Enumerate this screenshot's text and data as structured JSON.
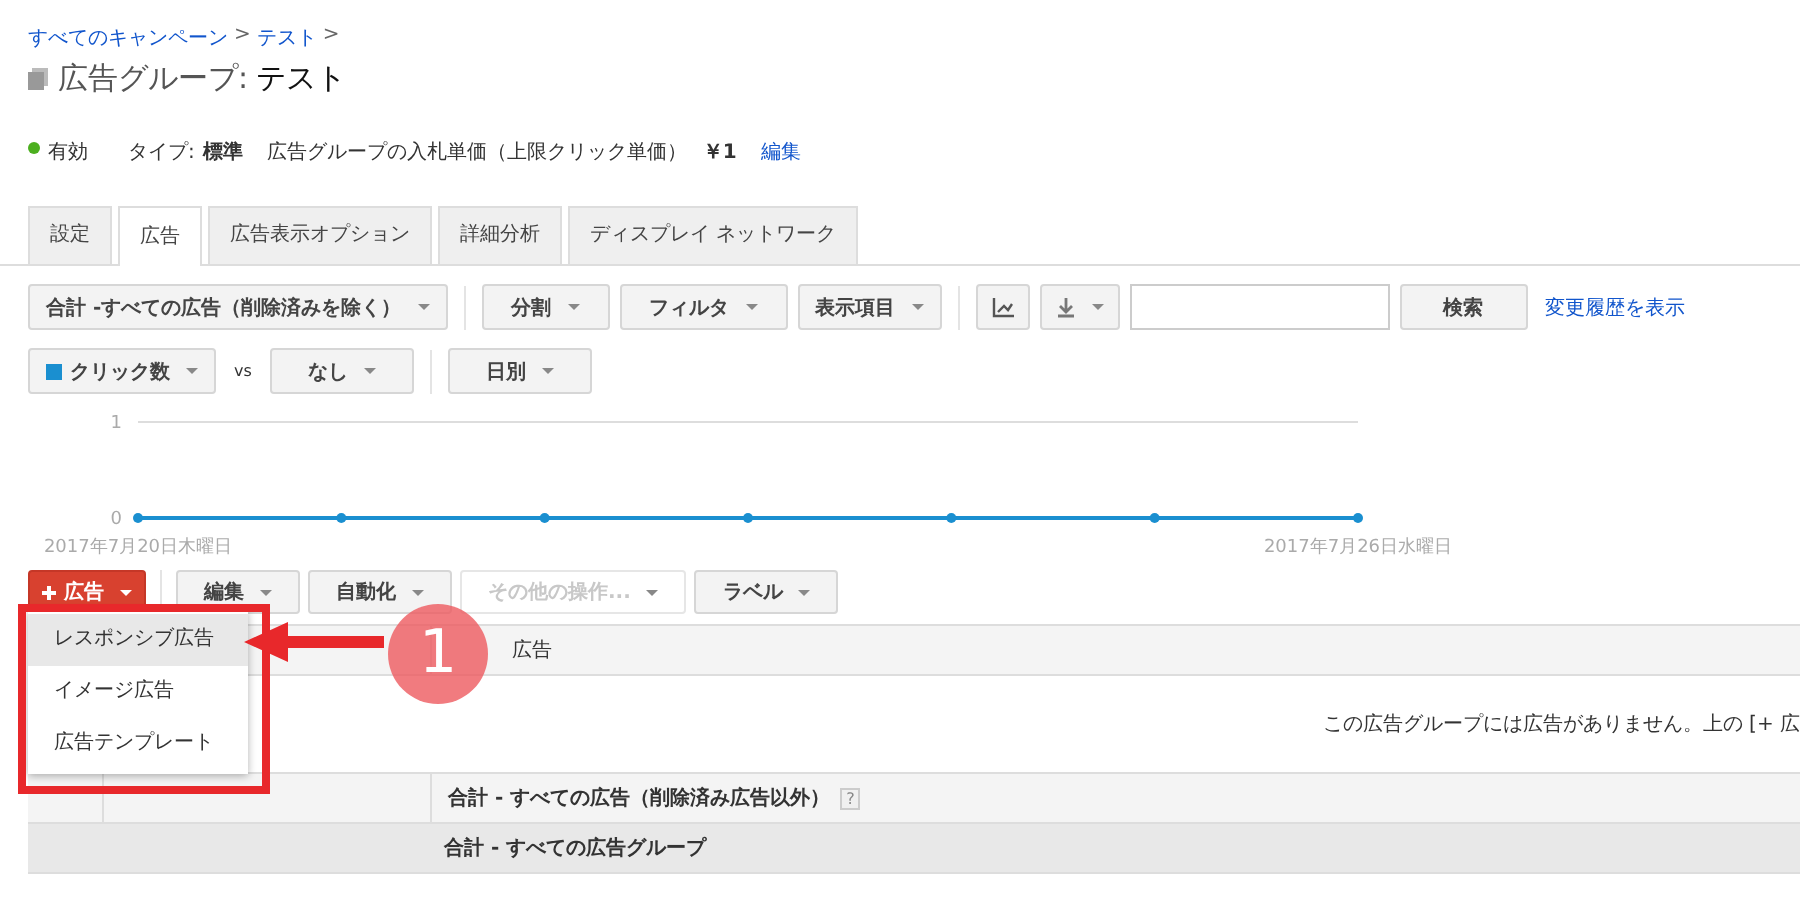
{
  "breadcrumb": [
    {
      "label": "すべてのキャンペーン"
    },
    {
      "label": "テスト"
    }
  ],
  "breadcrumb_separator": ">",
  "title": {
    "prefix": "広告グループ:",
    "name": "テスト"
  },
  "status": {
    "label": "有効",
    "color": "#4caf1f"
  },
  "summary": {
    "type_label": "タイプ:",
    "type_value": "標準",
    "bid_label": "広告グループの入札単価（上限クリック単価）",
    "bid_value": "￥1",
    "edit_link": "編集"
  },
  "tabs": [
    {
      "label": "設定",
      "selected": false
    },
    {
      "label": "広告",
      "selected": true
    },
    {
      "label": "広告表示オプション",
      "selected": false
    },
    {
      "label": "詳細分析",
      "selected": false
    },
    {
      "label": "ディスプレイ ネットワーク",
      "selected": false
    }
  ],
  "toolbar": {
    "scope": "合計 -すべての広告（削除済みを除く）",
    "segment": "分割",
    "filter": "フィルタ",
    "columns": "表示項目",
    "search_button": "検索",
    "history_link": "変更履歴を表示"
  },
  "metrics": {
    "vs": "vs",
    "secondary": "なし",
    "period": "日別"
  },
  "chart_data": {
    "type": "line",
    "categories": [
      "2017年7月20日木曜日",
      null,
      null,
      null,
      null,
      null,
      "2017年7月26日水曜日"
    ],
    "yticks": [
      0,
      1
    ],
    "ylim": [
      0,
      1
    ],
    "series": [
      {
        "name": "クリック数",
        "color": "#1a8fd0",
        "values": [
          0,
          0,
          0,
          0,
          0,
          0,
          0
        ],
        "marker": true
      }
    ]
  },
  "actions": [
    {
      "label": "広告",
      "kind": "primary",
      "disabled": false
    },
    {
      "label": "編集",
      "kind": "dropdown",
      "disabled": false
    },
    {
      "label": "自動化",
      "kind": "dropdown",
      "disabled": false
    },
    {
      "label": "その他の操作...",
      "kind": "dropdown",
      "disabled": true
    },
    {
      "label": "ラベル",
      "kind": "dropdown",
      "disabled": false
    }
  ],
  "menu": [
    {
      "label": "レスポンシブ広告",
      "selected": true
    },
    {
      "label": "イメージ広告",
      "selected": false
    },
    {
      "label": "広告テンプレート",
      "selected": false
    }
  ],
  "annotation": {
    "number": "1"
  },
  "table": {
    "header": "広告",
    "empty_message": "この広告グループには広告がありません。上の [+ 広",
    "total_row": "合計 - すべての広告（削除済み広告以外）",
    "help": "?",
    "group_total_row": "合計 - すべての広告グループ"
  }
}
